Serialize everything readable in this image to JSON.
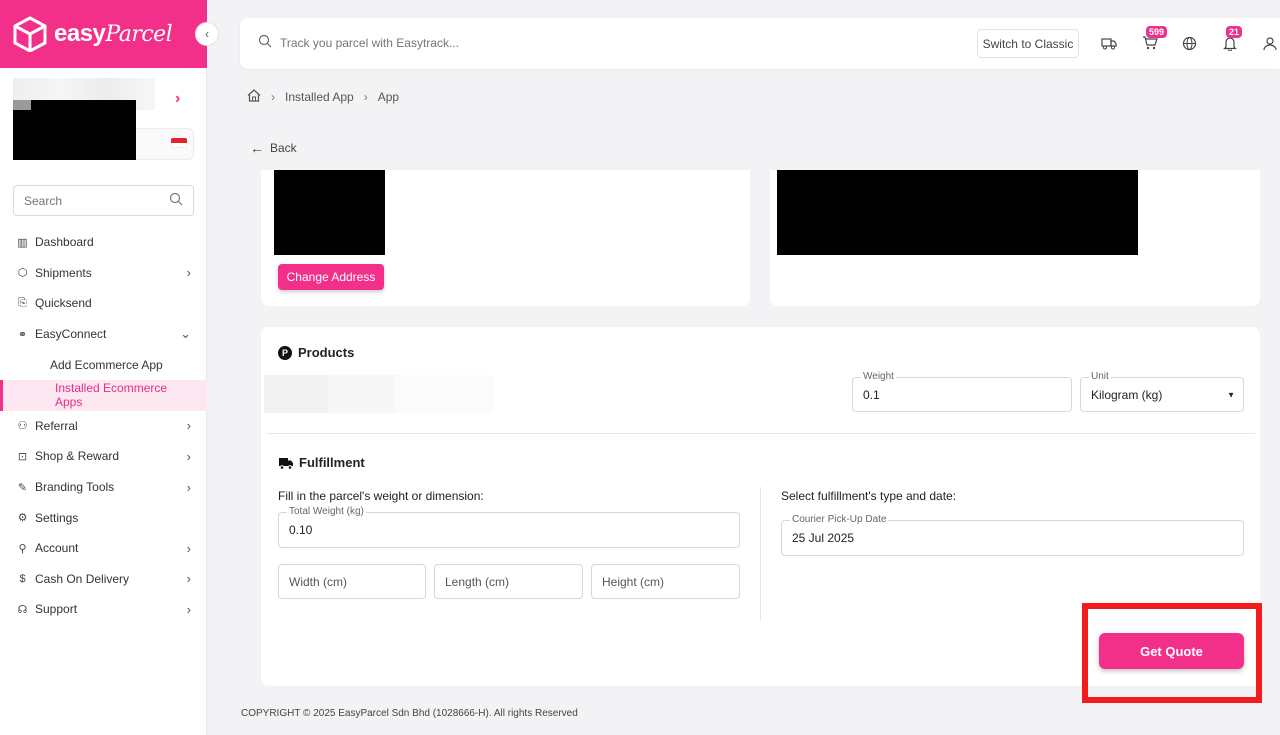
{
  "brand": {
    "name": "easy",
    "name_italic": "Parcel",
    "color": "#f2308a"
  },
  "sidebar": {
    "search_placeholder": "Search",
    "items": [
      {
        "label": "Dashboard",
        "icon": "chart-icon"
      },
      {
        "label": "Shipments",
        "icon": "box-icon"
      },
      {
        "label": "Quicksend",
        "icon": "send-icon"
      },
      {
        "label": "EasyConnect",
        "icon": "link-icon"
      },
      {
        "label": "Add Ecommerce App"
      },
      {
        "label": "Installed Ecommerce Apps"
      },
      {
        "label": "Referral",
        "icon": "users-icon"
      },
      {
        "label": "Shop & Reward",
        "icon": "bag-icon"
      },
      {
        "label": "Branding Tools",
        "icon": "brush-icon"
      },
      {
        "label": "Settings",
        "icon": "gear-icon"
      },
      {
        "label": "Account",
        "icon": "user-icon"
      },
      {
        "label": "Cash On Delivery",
        "icon": "dollar-icon"
      },
      {
        "label": "Support",
        "icon": "headset-icon"
      }
    ]
  },
  "topbar": {
    "search_placeholder": "Track you parcel with Easytrack...",
    "switch_label": "Switch to Classic",
    "cart_badge": "599",
    "notif_badge": "21"
  },
  "breadcrumb": {
    "item1": "Installed App",
    "item2": "App"
  },
  "back_label": "Back",
  "change_address_label": "Change Address",
  "products": {
    "title": "Products",
    "weight_label": "Weight",
    "weight_value": "0.1",
    "unit_label": "Unit",
    "unit_value": "Kilogram (kg)"
  },
  "fulfillment": {
    "title": "Fulfillment",
    "left_prompt": "Fill in the parcel's weight or dimension:",
    "total_weight_label": "Total Weight (kg)",
    "total_weight_value": "0.10",
    "width_placeholder": "Width (cm)",
    "length_placeholder": "Length (cm)",
    "height_placeholder": "Height (cm)",
    "right_prompt": "Select fulfillment's type and date:",
    "pickup_label": "Courier Pick-Up Date",
    "pickup_value": "25 Jul 2025"
  },
  "get_quote_label": "Get Quote",
  "footer": "COPYRIGHT © 2025 EasyParcel Sdn Bhd (1028666-H). All rights Reserved"
}
